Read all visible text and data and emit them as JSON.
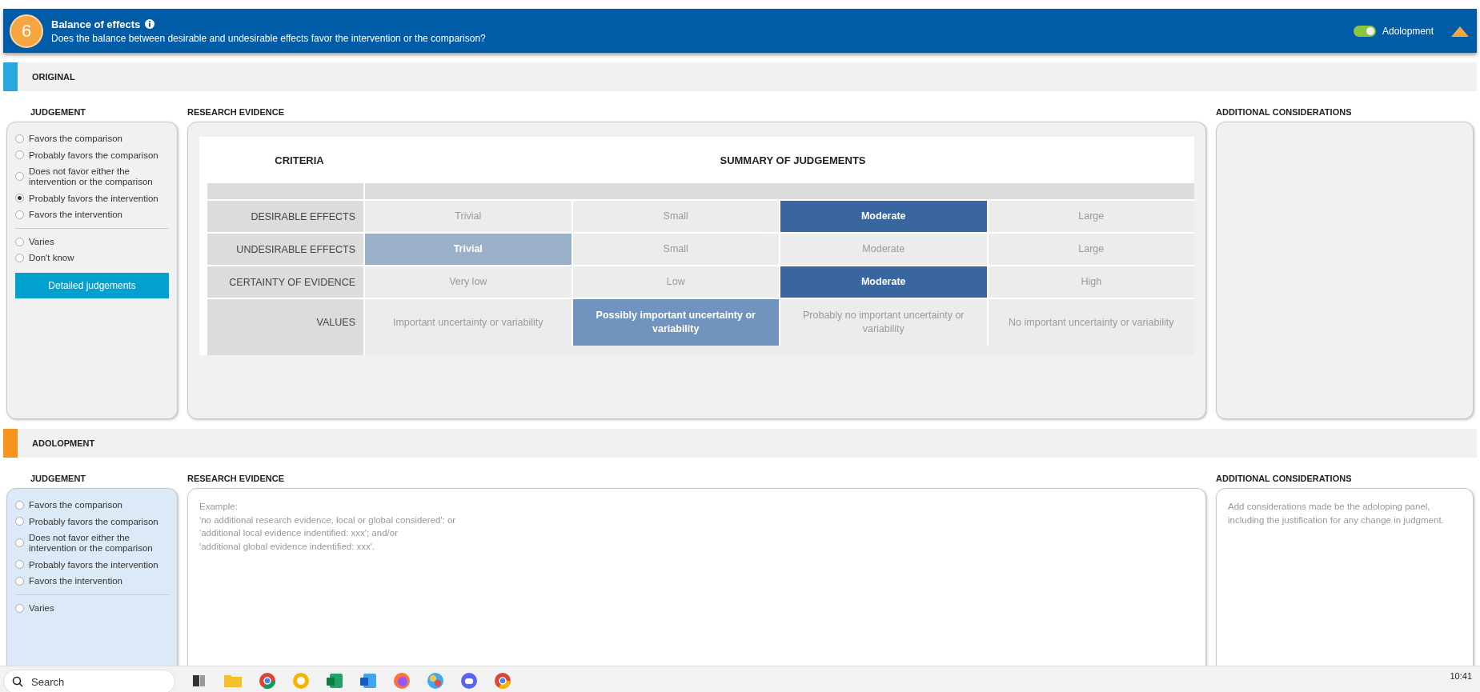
{
  "header": {
    "number": "6",
    "title": "Balance of effects",
    "question": "Does the balance between desirable and undesirable effects favor the intervention or the comparison?",
    "toggle": {
      "label": "Adolopment",
      "on": true
    }
  },
  "sections": [
    {
      "kind": "original",
      "title": "ORIGINAL",
      "judgement": {
        "heading": "JUDGEMENT",
        "options": [
          {
            "label": "Favors the comparison",
            "selected": false
          },
          {
            "label": "Probably favors the comparison",
            "selected": false
          },
          {
            "label": "Does not favor either the intervention or the comparison",
            "selected": false
          },
          {
            "label": "Probably favors the intervention",
            "selected": true
          },
          {
            "label": "Favors the intervention",
            "selected": false
          }
        ],
        "other_options": [
          {
            "label": "Varies",
            "selected": false
          },
          {
            "label": "Don't know",
            "selected": false
          }
        ],
        "button": "Detailed judgements"
      },
      "research": {
        "heading": "RESEARCH EVIDENCE",
        "table": {
          "criteria_heading": "CRITERIA",
          "summary_heading": "SUMMARY OF JUDGEMENTS",
          "rows": [
            {
              "criterion": "DESIRABLE EFFECTS",
              "color": "#3a66a0",
              "cells": [
                {
                  "label": "Trivial",
                  "selected": false
                },
                {
                  "label": "Small",
                  "selected": false
                },
                {
                  "label": "Moderate",
                  "selected": true
                },
                {
                  "label": "Large",
                  "selected": false
                }
              ]
            },
            {
              "criterion": "UNDESIRABLE EFFECTS",
              "color": "#9ab0c8",
              "cells": [
                {
                  "label": "Trivial",
                  "selected": true
                },
                {
                  "label": "Small",
                  "selected": false
                },
                {
                  "label": "Moderate",
                  "selected": false
                },
                {
                  "label": "Large",
                  "selected": false
                }
              ]
            },
            {
              "criterion": "CERTAINTY OF EVIDENCE",
              "color": "#3a66a0",
              "cells": [
                {
                  "label": "Very low",
                  "selected": false
                },
                {
                  "label": "Low",
                  "selected": false
                },
                {
                  "label": "Moderate",
                  "selected": true
                },
                {
                  "label": "High",
                  "selected": false
                }
              ]
            },
            {
              "criterion": "VALUES",
              "color": "#7094bd",
              "cells": [
                {
                  "label": "Important uncertainty or variability",
                  "selected": false
                },
                {
                  "label": "Possibly important uncertainty or variability",
                  "selected": true
                },
                {
                  "label": "Probably no important uncertainty or variability",
                  "selected": false
                },
                {
                  "label": "No important uncertainty or variability",
                  "selected": false
                }
              ]
            }
          ]
        }
      },
      "additional": {
        "heading": "ADDITIONAL CONSIDERATIONS"
      }
    },
    {
      "kind": "adolopment",
      "title": "ADOLOPMENT",
      "judgement": {
        "heading": "JUDGEMENT",
        "options": [
          {
            "label": "Favors the comparison",
            "selected": false
          },
          {
            "label": "Probably favors the comparison",
            "selected": false
          },
          {
            "label": "Does not favor either the intervention or the comparison",
            "selected": false
          },
          {
            "label": "Probably favors the intervention",
            "selected": false
          },
          {
            "label": "Favors the intervention",
            "selected": false
          }
        ],
        "other_options": [
          {
            "label": "Varies",
            "selected": false
          }
        ]
      },
      "research": {
        "heading": "RESEARCH EVIDENCE",
        "placeholder": "Example:\n'no additional research evidence, local or global considered': or\n'additional local evidence indentified: xxx'; and/or\n'additional global evidence indentified: xxx'."
      },
      "additional": {
        "heading": "ADDITIONAL CONSIDERATIONS",
        "placeholder": "Add considerations made be the adoloping panel, including the justification for any change in judgment."
      }
    }
  ],
  "taskbar": {
    "search": {
      "placeholder": "Search"
    },
    "time": "10:41"
  }
}
